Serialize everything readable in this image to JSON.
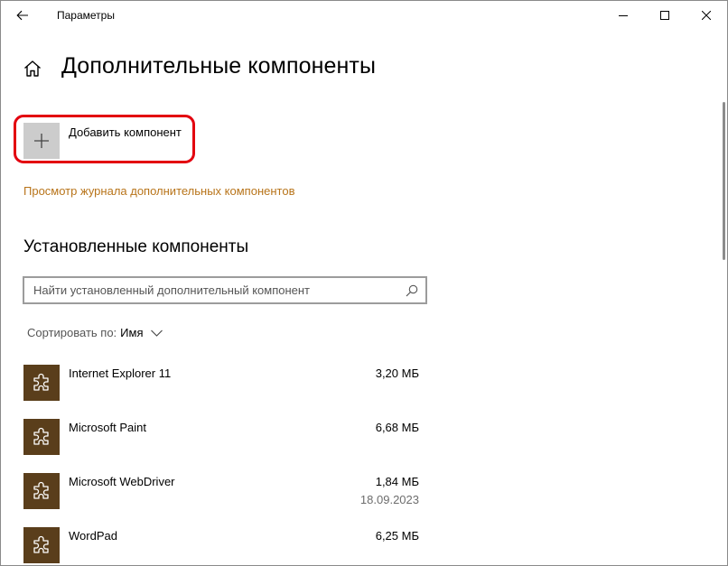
{
  "window": {
    "title": "Параметры"
  },
  "header": {
    "title": "Дополнительные компоненты"
  },
  "add_feature": {
    "label": "Добавить компонент"
  },
  "history_link": "Просмотр журнала дополнительных компонентов",
  "installed": {
    "title": "Установленные компоненты",
    "search_placeholder": "Найти установленный дополнительный компонент",
    "sort_label": "Сортировать по:",
    "sort_value": "Имя",
    "items": [
      {
        "name": "Internet Explorer 11",
        "size": "3,20 МБ",
        "date": ""
      },
      {
        "name": "Microsoft Paint",
        "size": "6,68 МБ",
        "date": ""
      },
      {
        "name": "Microsoft WebDriver",
        "size": "1,84 МБ",
        "date": "18.09.2023"
      },
      {
        "name": "WordPad",
        "size": "6,25 МБ",
        "date": ""
      }
    ]
  },
  "colors": {
    "accent_link": "#b8741a",
    "feature_icon_bg": "#5a3e1b",
    "highlight": "#e3000f"
  },
  "icons": {
    "back": "back-arrow-icon",
    "home": "home-icon",
    "add": "plus-icon",
    "search": "search-icon",
    "feature": "puzzle-icon"
  }
}
